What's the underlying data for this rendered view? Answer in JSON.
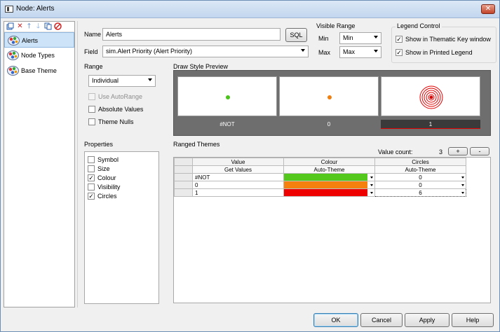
{
  "window": {
    "title": "Node: Alerts",
    "close_glyph": "✕"
  },
  "tree": {
    "items": [
      {
        "label": "Alerts",
        "selected": true
      },
      {
        "label": "Node Types",
        "selected": false
      },
      {
        "label": "Base Theme",
        "selected": false
      }
    ]
  },
  "form": {
    "name_label": "Name",
    "name_value": "Alerts",
    "sql_button": "SQL",
    "field_label": "Field",
    "field_value": "sim.Alert Priority (Alert Priority)"
  },
  "visible_range": {
    "title": "Visible Range",
    "min_label": "Min",
    "min_value": "Min",
    "max_label": "Max",
    "max_value": "Max"
  },
  "legend_control": {
    "title": "Legend Control",
    "show_thematic": "Show in Thematic Key window",
    "show_printed": "Show in Printed Legend"
  },
  "range": {
    "title": "Range",
    "mode_value": "Individual",
    "use_autorange": "Use AutoRange",
    "absolute_values": "Absolute Values",
    "theme_nulls": "Theme Nulls"
  },
  "preview": {
    "title": "Draw Style Preview",
    "labels": [
      "#NOT",
      "0",
      "1"
    ],
    "dot_colors": [
      "#4cc31c",
      "#f07f10",
      "#e00000"
    ]
  },
  "properties": {
    "title": "Properties",
    "items": [
      {
        "label": "Symbol",
        "checked": false
      },
      {
        "label": "Size",
        "checked": false
      },
      {
        "label": "Colour",
        "checked": true
      },
      {
        "label": "Visibility",
        "checked": false
      },
      {
        "label": "Circles",
        "checked": true
      }
    ]
  },
  "ranged_themes": {
    "title": "Ranged Themes",
    "value_count_label": "Value count:",
    "value_count": "3",
    "add_btn": "+",
    "remove_btn": "-",
    "columns": [
      "Value",
      "Colour",
      "Circles"
    ],
    "sub_headers": [
      "Get Values",
      "Auto-Theme",
      "Auto-Theme"
    ],
    "rows": [
      {
        "value": "#NOT",
        "colour": "#55c81e",
        "circles": "0"
      },
      {
        "value": "0",
        "colour": "#f5800e",
        "circles": "0"
      },
      {
        "value": "1",
        "colour": "#ef0000",
        "circles": "6"
      }
    ]
  },
  "footer": {
    "ok": "OK",
    "cancel": "Cancel",
    "apply": "Apply",
    "help": "Help"
  }
}
